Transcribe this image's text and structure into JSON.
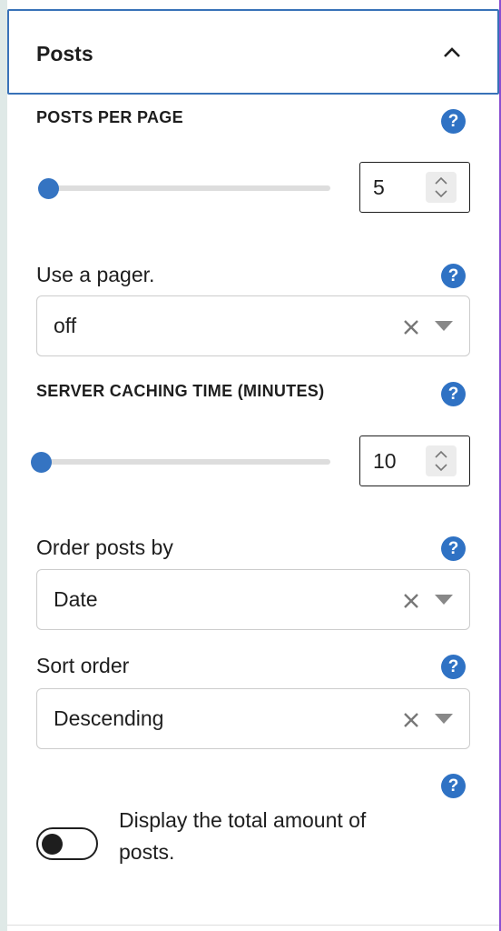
{
  "panel": {
    "title": "Posts",
    "chevron_icon": "chevron-up-icon"
  },
  "posts_per_page": {
    "label": "POSTS PER PAGE",
    "help": "?",
    "value": "5",
    "slider_fraction": 0.03
  },
  "pager": {
    "label": "Use a pager.",
    "help": "?",
    "selected": "off"
  },
  "caching": {
    "label": "SERVER CACHING TIME (MINUTES)",
    "help": "?",
    "value": "10",
    "slider_fraction": 0.0
  },
  "order_by": {
    "label": "Order posts by",
    "help": "?",
    "selected": "Date"
  },
  "sort_order": {
    "label": "Sort order",
    "help": "?",
    "selected": "Descending"
  },
  "total_toggle": {
    "help": "?",
    "label": "Display the total amount of posts.",
    "enabled": false
  },
  "colors": {
    "accent": "#3574c2",
    "help_icon": "#2f72c4",
    "header_border": "#3872b8"
  }
}
